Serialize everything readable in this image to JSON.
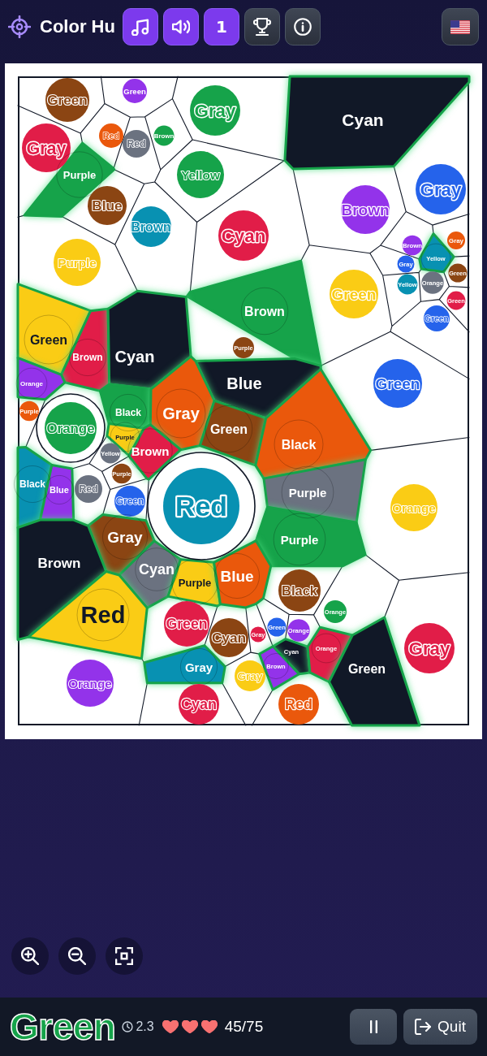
{
  "header": {
    "title": "Color Hu",
    "buttons": [
      {
        "kind": "music",
        "on": true
      },
      {
        "kind": "sound",
        "on": true
      },
      {
        "kind": "level",
        "label": "1",
        "on": true
      },
      {
        "kind": "trophy",
        "on": false
      },
      {
        "kind": "info",
        "on": false
      }
    ],
    "language_button": {
      "kind": "us_flag"
    }
  },
  "cells": [
    {
      "label": "Green",
      "color": "#8b4513",
      "found": false,
      "highlighted": false
    },
    {
      "label": "Green",
      "color": "#9333ea",
      "found": false,
      "highlighted": false
    },
    {
      "label": "Gray",
      "color": "#16a34a",
      "found": false,
      "highlighted": false
    },
    {
      "label": "Cyan",
      "color": "#111827",
      "found": true,
      "highlighted": false
    },
    {
      "label": "Gray",
      "color": "#e11d48",
      "found": false,
      "highlighted": false
    },
    {
      "label": "Red",
      "color": "#ea580c",
      "found": false,
      "highlighted": false
    },
    {
      "label": "Red",
      "color": "#6b7280",
      "found": false,
      "highlighted": false
    },
    {
      "label": "Brown",
      "color": "#16a34a",
      "found": false,
      "highlighted": false
    },
    {
      "label": "Purple",
      "color": "#16a34a",
      "found": true,
      "highlighted": false
    },
    {
      "label": "Blue",
      "color": "#8b4513",
      "found": false,
      "highlighted": false
    },
    {
      "label": "Yellow",
      "color": "#16a34a",
      "found": false,
      "highlighted": false
    },
    {
      "label": "Brown",
      "color": "#9333ea",
      "found": false,
      "highlighted": false
    },
    {
      "label": "Gray",
      "color": "#2563eb",
      "found": false,
      "highlighted": false
    },
    {
      "label": "Brown",
      "color": "#0891b2",
      "found": false,
      "highlighted": false
    },
    {
      "label": "Cyan",
      "color": "#e11d48",
      "found": false,
      "highlighted": false
    },
    {
      "label": "Brown",
      "color": "#9333ea",
      "found": false,
      "highlighted": false
    },
    {
      "label": "Gray",
      "color": "#ea580c",
      "found": false,
      "highlighted": false
    },
    {
      "label": "Purple",
      "color": "#facc15",
      "found": false,
      "highlighted": false
    },
    {
      "label": "Gray",
      "color": "#2563eb",
      "found": false,
      "highlighted": false
    },
    {
      "label": "Yellow",
      "color": "#0891b2",
      "found": true,
      "highlighted": false
    },
    {
      "label": "Green",
      "color": "#8b4513",
      "found": false,
      "highlighted": false
    },
    {
      "label": "Brown",
      "color": "#16a34a",
      "found": true,
      "highlighted": false
    },
    {
      "label": "Green",
      "color": "#facc15",
      "found": false,
      "highlighted": false
    },
    {
      "label": "Yellow",
      "color": "#0891b2",
      "found": false,
      "highlighted": false
    },
    {
      "label": "Orange",
      "color": "#6b7280",
      "found": false,
      "highlighted": false
    },
    {
      "label": "Green",
      "color": "#e11d48",
      "found": false,
      "highlighted": false
    },
    {
      "label": "Green",
      "color": "#2563eb",
      "found": false,
      "highlighted": false
    },
    {
      "label": "Green",
      "color": "#facc15",
      "found": true,
      "highlighted": false
    },
    {
      "label": "Brown",
      "color": "#e11d48",
      "found": true,
      "highlighted": false
    },
    {
      "label": "Cyan",
      "color": "#111827",
      "found": true,
      "highlighted": false
    },
    {
      "label": "Purple",
      "color": "#8b4513",
      "found": false,
      "highlighted": false
    },
    {
      "label": "Orange",
      "color": "#9333ea",
      "found": true,
      "highlighted": false
    },
    {
      "label": "Blue",
      "color": "#111827",
      "found": true,
      "highlighted": false
    },
    {
      "label": "Green",
      "color": "#2563eb",
      "found": false,
      "highlighted": false
    },
    {
      "label": "Purple",
      "color": "#ea580c",
      "found": false,
      "highlighted": false
    },
    {
      "label": "Orange",
      "color": "#16a34a",
      "found": false,
      "highlighted": true
    },
    {
      "label": "Black",
      "color": "#16a34a",
      "found": true,
      "highlighted": false
    },
    {
      "label": "Purple",
      "color": "#facc15",
      "found": true,
      "highlighted": false
    },
    {
      "label": "Gray",
      "color": "#ea580c",
      "found": true,
      "highlighted": false
    },
    {
      "label": "Yellow",
      "color": "#6b7280",
      "found": false,
      "highlighted": false
    },
    {
      "label": "Brown",
      "color": "#e11d48",
      "found": true,
      "highlighted": false
    },
    {
      "label": "Green",
      "color": "#8b4513",
      "found": true,
      "highlighted": false
    },
    {
      "label": "Black",
      "color": "#ea580c",
      "found": true,
      "highlighted": false
    },
    {
      "label": "Purple",
      "color": "#8b4513",
      "found": false,
      "highlighted": false
    },
    {
      "label": "Black",
      "color": "#0891b2",
      "found": true,
      "highlighted": false
    },
    {
      "label": "Blue",
      "color": "#9333ea",
      "found": true,
      "highlighted": false
    },
    {
      "label": "Red",
      "color": "#6b7280",
      "found": false,
      "highlighted": false
    },
    {
      "label": "Green",
      "color": "#2563eb",
      "found": false,
      "highlighted": false
    },
    {
      "label": "Red",
      "color": "#0891b2",
      "found": false,
      "highlighted": true
    },
    {
      "label": "Purple",
      "color": "#6b7280",
      "found": true,
      "highlighted": false
    },
    {
      "label": "Orange",
      "color": "#facc15",
      "found": false,
      "highlighted": false
    },
    {
      "label": "Gray",
      "color": "#8b4513",
      "found": true,
      "highlighted": false
    },
    {
      "label": "Purple",
      "color": "#16a34a",
      "found": true,
      "highlighted": false
    },
    {
      "label": "Brown",
      "color": "#111827",
      "found": true,
      "highlighted": false
    },
    {
      "label": "Cyan",
      "color": "#6b7280",
      "found": true,
      "highlighted": false
    },
    {
      "label": "Purple",
      "color": "#facc15",
      "found": true,
      "highlighted": false
    },
    {
      "label": "Blue",
      "color": "#ea580c",
      "found": true,
      "highlighted": false
    },
    {
      "label": "Black",
      "color": "#8b4513",
      "found": false,
      "highlighted": false
    },
    {
      "label": "Red",
      "color": "#facc15",
      "found": true,
      "highlighted": false
    },
    {
      "label": "Green",
      "color": "#e11d48",
      "found": false,
      "highlighted": false
    },
    {
      "label": "Cyan",
      "color": "#8b4513",
      "found": false,
      "highlighted": false
    },
    {
      "label": "Gray",
      "color": "#e11d48",
      "found": false,
      "highlighted": false
    },
    {
      "label": "Green",
      "color": "#2563eb",
      "found": false,
      "highlighted": false
    },
    {
      "label": "Orange",
      "color": "#9333ea",
      "found": false,
      "highlighted": false
    },
    {
      "label": "Orange",
      "color": "#16a34a",
      "found": false,
      "highlighted": false
    },
    {
      "label": "Cyan",
      "color": "#111827",
      "found": true,
      "highlighted": false
    },
    {
      "label": "Orange",
      "color": "#e11d48",
      "found": true,
      "highlighted": false
    },
    {
      "label": "Gray",
      "color": "#e11d48",
      "found": false,
      "highlighted": false
    },
    {
      "label": "Orange",
      "color": "#9333ea",
      "found": false,
      "highlighted": false
    },
    {
      "label": "Gray",
      "color": "#0891b2",
      "found": true,
      "highlighted": false
    },
    {
      "label": "Gray",
      "color": "#facc15",
      "found": false,
      "highlighted": false
    },
    {
      "label": "Brown",
      "color": "#9333ea",
      "found": true,
      "highlighted": false
    },
    {
      "label": "Green",
      "color": "#111827",
      "found": true,
      "highlighted": false
    },
    {
      "label": "Cyan",
      "color": "#e11d48",
      "found": false,
      "highlighted": false
    },
    {
      "label": "Red",
      "color": "#ea580c",
      "found": false,
      "highlighted": false
    }
  ],
  "zoom_controls": [
    {
      "kind": "zoom_in"
    },
    {
      "kind": "zoom_out"
    },
    {
      "kind": "fit"
    }
  ],
  "status_bar": {
    "target": "Green",
    "timer": "2.3",
    "lives": [
      {
        "filled": true
      },
      {
        "filled": true
      },
      {
        "filled": true
      }
    ],
    "score": "45/75",
    "buttons": [
      {
        "kind": "pause"
      },
      {
        "kind": "quit",
        "label": "Quit"
      }
    ]
  }
}
